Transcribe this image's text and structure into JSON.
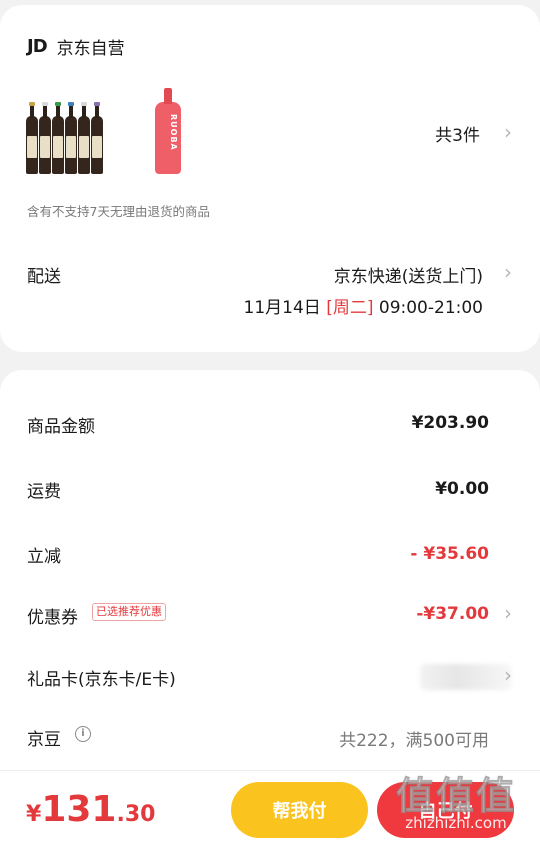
{
  "shop": {
    "logo": "JD",
    "name": "京东自营"
  },
  "products": {
    "liqueur_text": "RUOBA",
    "count": "共3件"
  },
  "notice": "含有不支持7天无理由退货的商品",
  "delivery": {
    "label": "配送",
    "method": "京东快递(送货上门)",
    "date": "11月14日",
    "day": "[周二]",
    "time": "09:00-21:00"
  },
  "summary": {
    "goods_label": "商品金额",
    "goods_value": "¥203.90",
    "shipping_label": "运费",
    "shipping_value": "¥0.00",
    "discount_label": "立减",
    "discount_value": "- ¥35.60",
    "coupon_label": "优惠券",
    "coupon_tag": "已选推荐优惠",
    "coupon_value": "-¥37.00",
    "giftcard_label": "礼品卡(京东卡/E卡)",
    "beans_label": "京豆",
    "beans_value": "共222，满500可用"
  },
  "bottom": {
    "yen": "¥",
    "total_int": "131",
    "total_dec": ".30",
    "help_pay": "帮我付",
    "self_pay": "自己付"
  },
  "watermark": {
    "big": "值值值",
    "small": "zhizhizhi.com"
  },
  "colors": {
    "accent_red": "#e4393c",
    "yellow_button": "#fbc31e",
    "red_button": "#f0393f"
  }
}
